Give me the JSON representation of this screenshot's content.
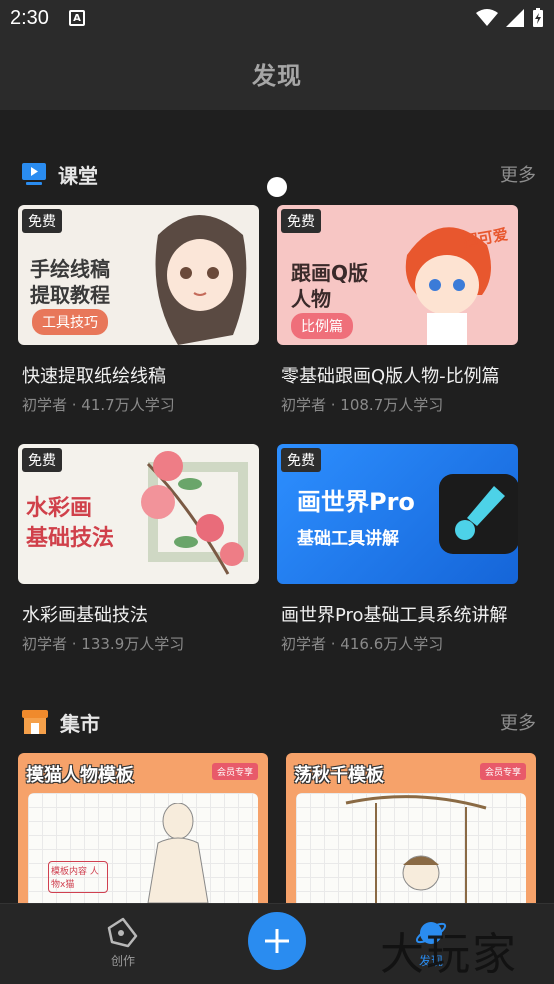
{
  "status": {
    "time": "2:30",
    "notif": "A"
  },
  "header": {
    "title": "发现"
  },
  "classroom": {
    "title": "课堂",
    "more": "更多",
    "courses": [
      {
        "badge": "免费",
        "thumb_line1": "手绘线稿",
        "thumb_line2": "提取教程",
        "thumb_tag": "工具技巧",
        "title": "快速提取纸绘线稿",
        "meta": "初学者 · 41.7万人学习"
      },
      {
        "badge": "免费",
        "thumb_line1": "跟画Q版",
        "thumb_line2": "人物",
        "thumb_tag": "比例篇",
        "thumb_extra": "超可爱",
        "title": "零基础跟画Q版人物-比例篇",
        "meta": "初学者 · 108.7万人学习"
      },
      {
        "badge": "免费",
        "thumb_line1": "水彩画",
        "thumb_line2": "基础技法",
        "title": "水彩画基础技法",
        "meta": "初学者 · 133.9万人学习"
      },
      {
        "badge": "免费",
        "thumb_line1": "画世界Pro",
        "thumb_line2": "基础工具讲解",
        "title": "画世界Pro基础工具系统讲解",
        "meta": "初学者 · 416.6万人学习"
      }
    ]
  },
  "market": {
    "title": "集市",
    "more": "更多",
    "items": [
      {
        "label": "摸猫人物模板",
        "vip": "会员专享",
        "note": "模板内容 人物x猫"
      },
      {
        "label": "荡秋千模板",
        "vip": "会员专享"
      }
    ]
  },
  "nav": {
    "create": "创作",
    "discover": "发现",
    "watermark": "大玩家"
  },
  "colors": {
    "accent": "#2a8cf0",
    "background": "#1f1f1f"
  }
}
